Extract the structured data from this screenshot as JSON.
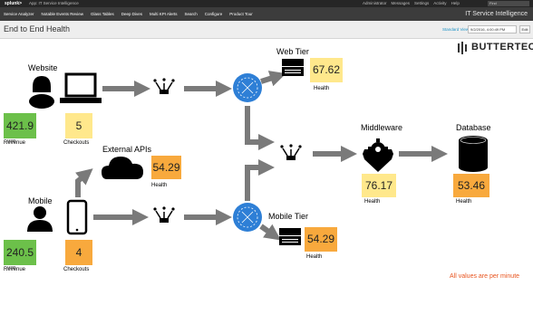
{
  "topbar": {
    "logo": "splunk>",
    "app_name": "App: IT Service Intelligence",
    "menu": [
      "Administrator",
      "Messages",
      "Settings",
      "Activity",
      "Help"
    ],
    "find_placeholder": "Find"
  },
  "navbar": {
    "items": [
      "Service Analyzer",
      "Notable Events Review",
      "Glass Tables",
      "Deep Dives",
      "Multi KPI Alerts",
      "Search",
      "Configure",
      "Product Tour"
    ],
    "app_title": "IT Service Intelligence"
  },
  "titlebar": {
    "page_title": "End to End Health",
    "standard_view": "Standard View",
    "date_value": "9/2/2016, 4:00:49 PM",
    "edit_label": "Edit"
  },
  "brand": "BUTTERTECH",
  "website": {
    "label": "Website",
    "revenue": {
      "value": "421.9",
      "unit": "USD",
      "label": "Revenue",
      "color": "#6cc04a"
    },
    "checkouts": {
      "value": "5",
      "label": "Checkouts",
      "color": "#ffe88c"
    }
  },
  "mobile": {
    "label": "Mobile",
    "revenue": {
      "value": "240.5",
      "unit": "USD",
      "label": "Revenue",
      "color": "#6cc04a"
    },
    "checkouts": {
      "value": "4",
      "label": "Checkouts",
      "color": "#f8a93d"
    }
  },
  "external_apis": {
    "label": "External APIs",
    "value": "54.29",
    "caption": "Health",
    "color": "#f8a93d"
  },
  "web_tier": {
    "label": "Web Tier",
    "value": "67.62",
    "caption": "Health",
    "color": "#ffe88c"
  },
  "mobile_tier": {
    "label": "Mobile Tier",
    "value": "54.29",
    "caption": "Health",
    "color": "#f8a93d"
  },
  "middleware": {
    "label": "Middleware",
    "value": "76.17",
    "caption": "Health",
    "color": "#ffe88c"
  },
  "database": {
    "label": "Database",
    "value": "53.46",
    "caption": "Health",
    "color": "#f8a93d"
  },
  "note": "All values are per minute"
}
